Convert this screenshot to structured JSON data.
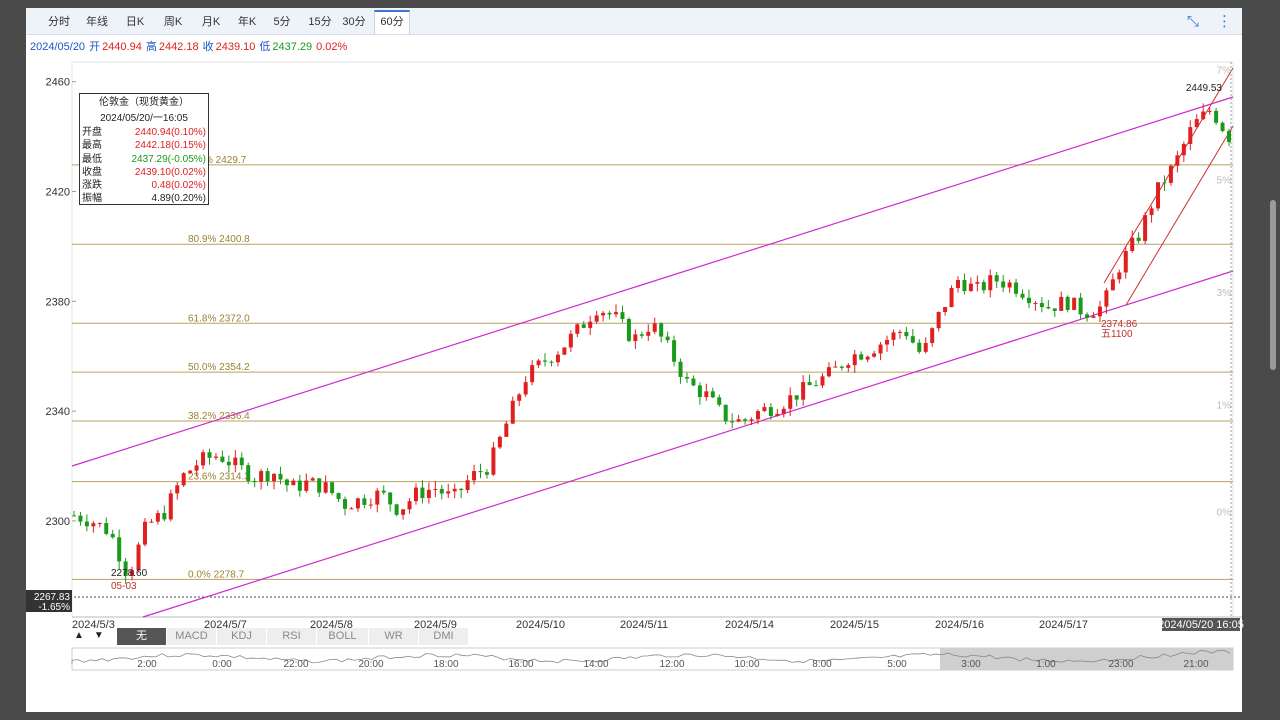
{
  "top_tabs": [
    "分时",
    "年线",
    "日K",
    "周K",
    "月K",
    "年K",
    "5分",
    "15分",
    "30分",
    "60分"
  ],
  "active_tab": "60分",
  "icons": {
    "fullscreen": "collapse-icon",
    "more": "more-vertical-icon"
  },
  "info": {
    "date": "2024/05/20",
    "open_label": "开",
    "open": "2440.94",
    "high_label": "高",
    "high": "2442.18",
    "close_label": "收",
    "close": "2439.10",
    "low_label": "低",
    "low": "2437.29",
    "change": "0.02%"
  },
  "tooltip": {
    "title": "伦敦金（现货黄金）",
    "time": "2024/05/20/一16:05",
    "rows": [
      {
        "k": "开盘",
        "v": "2440.94(0.10%)",
        "color": "#e02020"
      },
      {
        "k": "最高",
        "v": "2442.18(0.15%)",
        "color": "#e02020"
      },
      {
        "k": "最低",
        "v": "2437.29(-0.05%)",
        "color": "#1a9a1a"
      },
      {
        "k": "收盘",
        "v": "2439.10(0.02%)",
        "color": "#e02020"
      },
      {
        "k": "涨跌",
        "v": "0.48(0.02%)",
        "color": "#e02020"
      },
      {
        "k": "振幅",
        "v": "4.89(0.20%)",
        "color": "#222222"
      }
    ]
  },
  "colors": {
    "up": "#e02020",
    "down": "#1a9a1a",
    "fib": "#b8a060",
    "fib_text": "#a08030",
    "channel": "#d02ad0",
    "red_channel": "#d03030"
  },
  "chart_data": {
    "type": "candlestick",
    "title": "伦敦金（现货黄金）",
    "ylim": [
      2265,
      2465
    ],
    "y_ticks": [
      2300,
      2340,
      2380,
      2420,
      2460
    ],
    "pct_ticks": [
      "-2%",
      "0%",
      "1%",
      "3%",
      "5%",
      "7%"
    ],
    "x_labels": [
      "2024/5/3",
      "2024/5/7",
      "2024/5/8",
      "2024/5/9",
      "2024/5/10",
      "2024/5/11",
      "2024/5/14",
      "2024/5/15",
      "2024/5/16",
      "2024/5/17"
    ],
    "current_time_label": "2024/05/20 16:05",
    "cursor_price": {
      "value": "2267.83",
      "pct": "-1.65%"
    },
    "fib_levels": [
      {
        "label": "0.0% 2278.7",
        "value": 2278.7
      },
      {
        "label": "23.6% 2314.3",
        "value": 2314.3
      },
      {
        "label": "38.2% 2336.4",
        "value": 2336.4
      },
      {
        "label": "50.0% 2354.2",
        "value": 2354.2
      },
      {
        "label": "61.8% 2372.0",
        "value": 2372.0
      },
      {
        "label": "80.9% 2400.8",
        "value": 2400.8
      },
      {
        "label": "% 2429.7",
        "value": 2429.7
      }
    ],
    "annotations": [
      {
        "text": "2278.60",
        "sub": "05-03"
      },
      {
        "text": "2449.53"
      },
      {
        "text": "2374.86",
        "sub": "五1100"
      }
    ],
    "anchor_prices": [
      2302,
      2300,
      2296,
      2280,
      2298,
      2303,
      2316,
      2322,
      2324,
      2320,
      2316,
      2318,
      2312,
      2314,
      2312,
      2306,
      2308,
      2310,
      2304,
      2310,
      2312,
      2308,
      2316,
      2320,
      2336,
      2352,
      2358,
      2363,
      2370,
      2378,
      2374,
      2366,
      2372,
      2362,
      2350,
      2346,
      2338,
      2336,
      2340,
      2342,
      2346,
      2350,
      2354,
      2360,
      2362,
      2366,
      2370,
      2360,
      2376,
      2388,
      2384,
      2388,
      2386,
      2382,
      2378,
      2380,
      2376,
      2378,
      2394,
      2404,
      2420,
      2430,
      2444,
      2450,
      2440
    ]
  },
  "navigator": {
    "labels": [
      "2:00",
      "0:00",
      "22:00",
      "20:00",
      "18:00",
      "16:00",
      "14:00",
      "12:00",
      "10:00",
      "8:00",
      "5:00",
      "3:00",
      "1:00",
      "23:00",
      "21:00"
    ]
  },
  "indicators": {
    "tabs": [
      "无",
      "MACD",
      "KDJ",
      "RSI",
      "BOLL",
      "WR",
      "DMI"
    ],
    "active": "无",
    "up_arrow": "▲",
    "down_arrow": "▼"
  }
}
